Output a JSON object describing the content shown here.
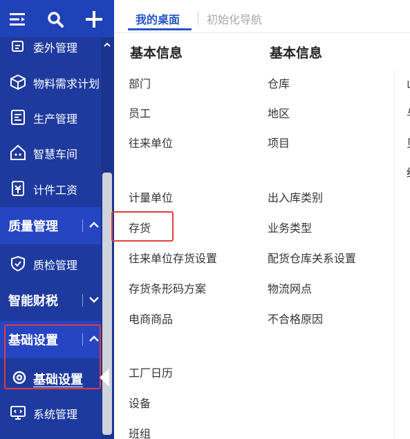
{
  "sidebar": {
    "items": [
      {
        "label": "委外管理",
        "icon": "outsourcing-icon"
      },
      {
        "label": "物料需求计划",
        "icon": "material-box-icon"
      },
      {
        "label": "生产管理",
        "icon": "production-icon"
      },
      {
        "label": "智慧车间",
        "icon": "robot-icon"
      },
      {
        "label": "计件工资",
        "icon": "wage-icon"
      },
      {
        "label": "质检管理",
        "icon": "quality-shield-icon"
      },
      {
        "label": "基础设置",
        "icon": "gear-icon"
      },
      {
        "label": "系统管理",
        "icon": "monitor-code-icon"
      }
    ],
    "groups": [
      {
        "label": "质量管理",
        "state": "expanded"
      },
      {
        "label": "智能财税",
        "state": "collapsed"
      },
      {
        "label": "基础设置",
        "state": "expanded"
      }
    ]
  },
  "tabs": [
    {
      "label": "我的桌面",
      "active": true
    },
    {
      "label": "初始化导航",
      "active": false
    }
  ],
  "columns": [
    {
      "heading": "基本信息",
      "items": [
        "部门",
        "员工",
        "往来单位",
        "计量单位",
        "存货",
        "往来单位存货设置",
        "存货条形码方案",
        "电商商品",
        "工厂日历",
        "设备",
        "班组"
      ]
    },
    {
      "heading": "基本信息",
      "items": [
        "仓库",
        "地区",
        "项目",
        "出入库类别",
        "业务类型",
        "配货仓库关系设置",
        "物流网点",
        "不合格原因"
      ]
    }
  ],
  "partial_column": [
    "山",
    "与",
    "贝",
    "结"
  ],
  "colors": {
    "sidebar": "#1e3a9e",
    "topbar": "#2042b8",
    "group": "#2545c2",
    "accent": "#2454c5",
    "highlight": "#e23c3c"
  }
}
